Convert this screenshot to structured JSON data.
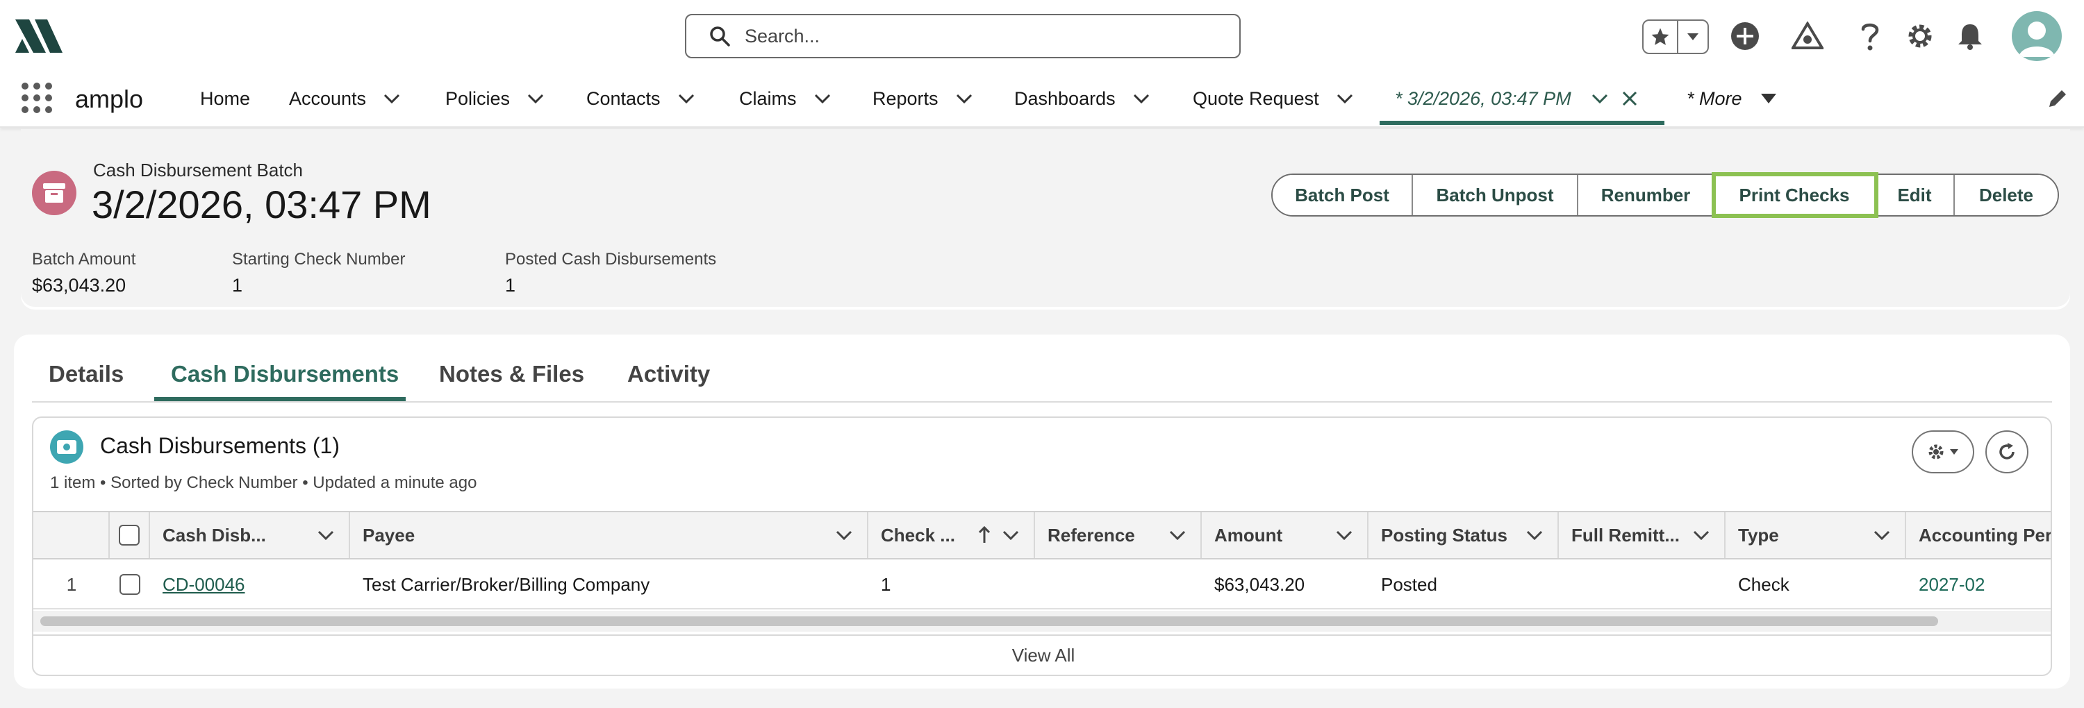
{
  "header": {
    "search_placeholder": "Search...",
    "icons": [
      "logo-icon",
      "search-icon",
      "favorites-star-icon",
      "chevron-down-icon",
      "add-icon",
      "trailhead-icon",
      "help-icon",
      "setup-gear-icon",
      "notifications-bell-icon",
      "avatar-icon"
    ]
  },
  "nav": {
    "app_name": "amplo",
    "items": [
      {
        "label": "Home"
      },
      {
        "label": "Accounts"
      },
      {
        "label": "Policies"
      },
      {
        "label": "Contacts"
      },
      {
        "label": "Claims"
      },
      {
        "label": "Reports"
      },
      {
        "label": "Dashboards"
      },
      {
        "label": "Quote Request"
      }
    ],
    "active_tab": "* 3/2/2026, 03:47 PM",
    "more": "* More"
  },
  "record": {
    "type": "Cash Disbursement Batch",
    "title": "3/2/2026, 03:47 PM",
    "actions": [
      "Batch Post",
      "Batch Unpost",
      "Renumber",
      "Print Checks",
      "Edit",
      "Delete"
    ],
    "highlighted_action": "Print Checks",
    "fields": [
      {
        "label": "Batch Amount",
        "value": "$63,043.20"
      },
      {
        "label": "Starting Check Number",
        "value": "1"
      },
      {
        "label": "Posted Cash Disbursements",
        "value": "1"
      }
    ]
  },
  "tabs": [
    "Details",
    "Cash Disbursements",
    "Notes & Files",
    "Activity"
  ],
  "active_tab_index": 1,
  "related_list": {
    "title": "Cash Disbursements (1)",
    "meta": "1 item • Sorted by Check Number • Updated a minute ago",
    "columns": [
      "Cash Disb...",
      "Payee",
      "Check ...",
      "Reference",
      "Amount",
      "Posting Status",
      "Full Remitt...",
      "Type",
      "Accounting Period"
    ],
    "rows": [
      {
        "row_number": "1",
        "name": "CD-00046",
        "payee": "Test Carrier/Broker/Billing Company",
        "check": "1",
        "reference": "",
        "amount": "$63,043.20",
        "posting_status": "Posted",
        "full_remittance": "",
        "type": "Check",
        "accounting_period": "2027-02"
      }
    ],
    "view_all": "View All"
  },
  "colors": {
    "brand_green": "#2e6b5e",
    "highlight": "#8cc152",
    "record_icon": "#c96a80",
    "list_icon": "#3ea6b2"
  }
}
